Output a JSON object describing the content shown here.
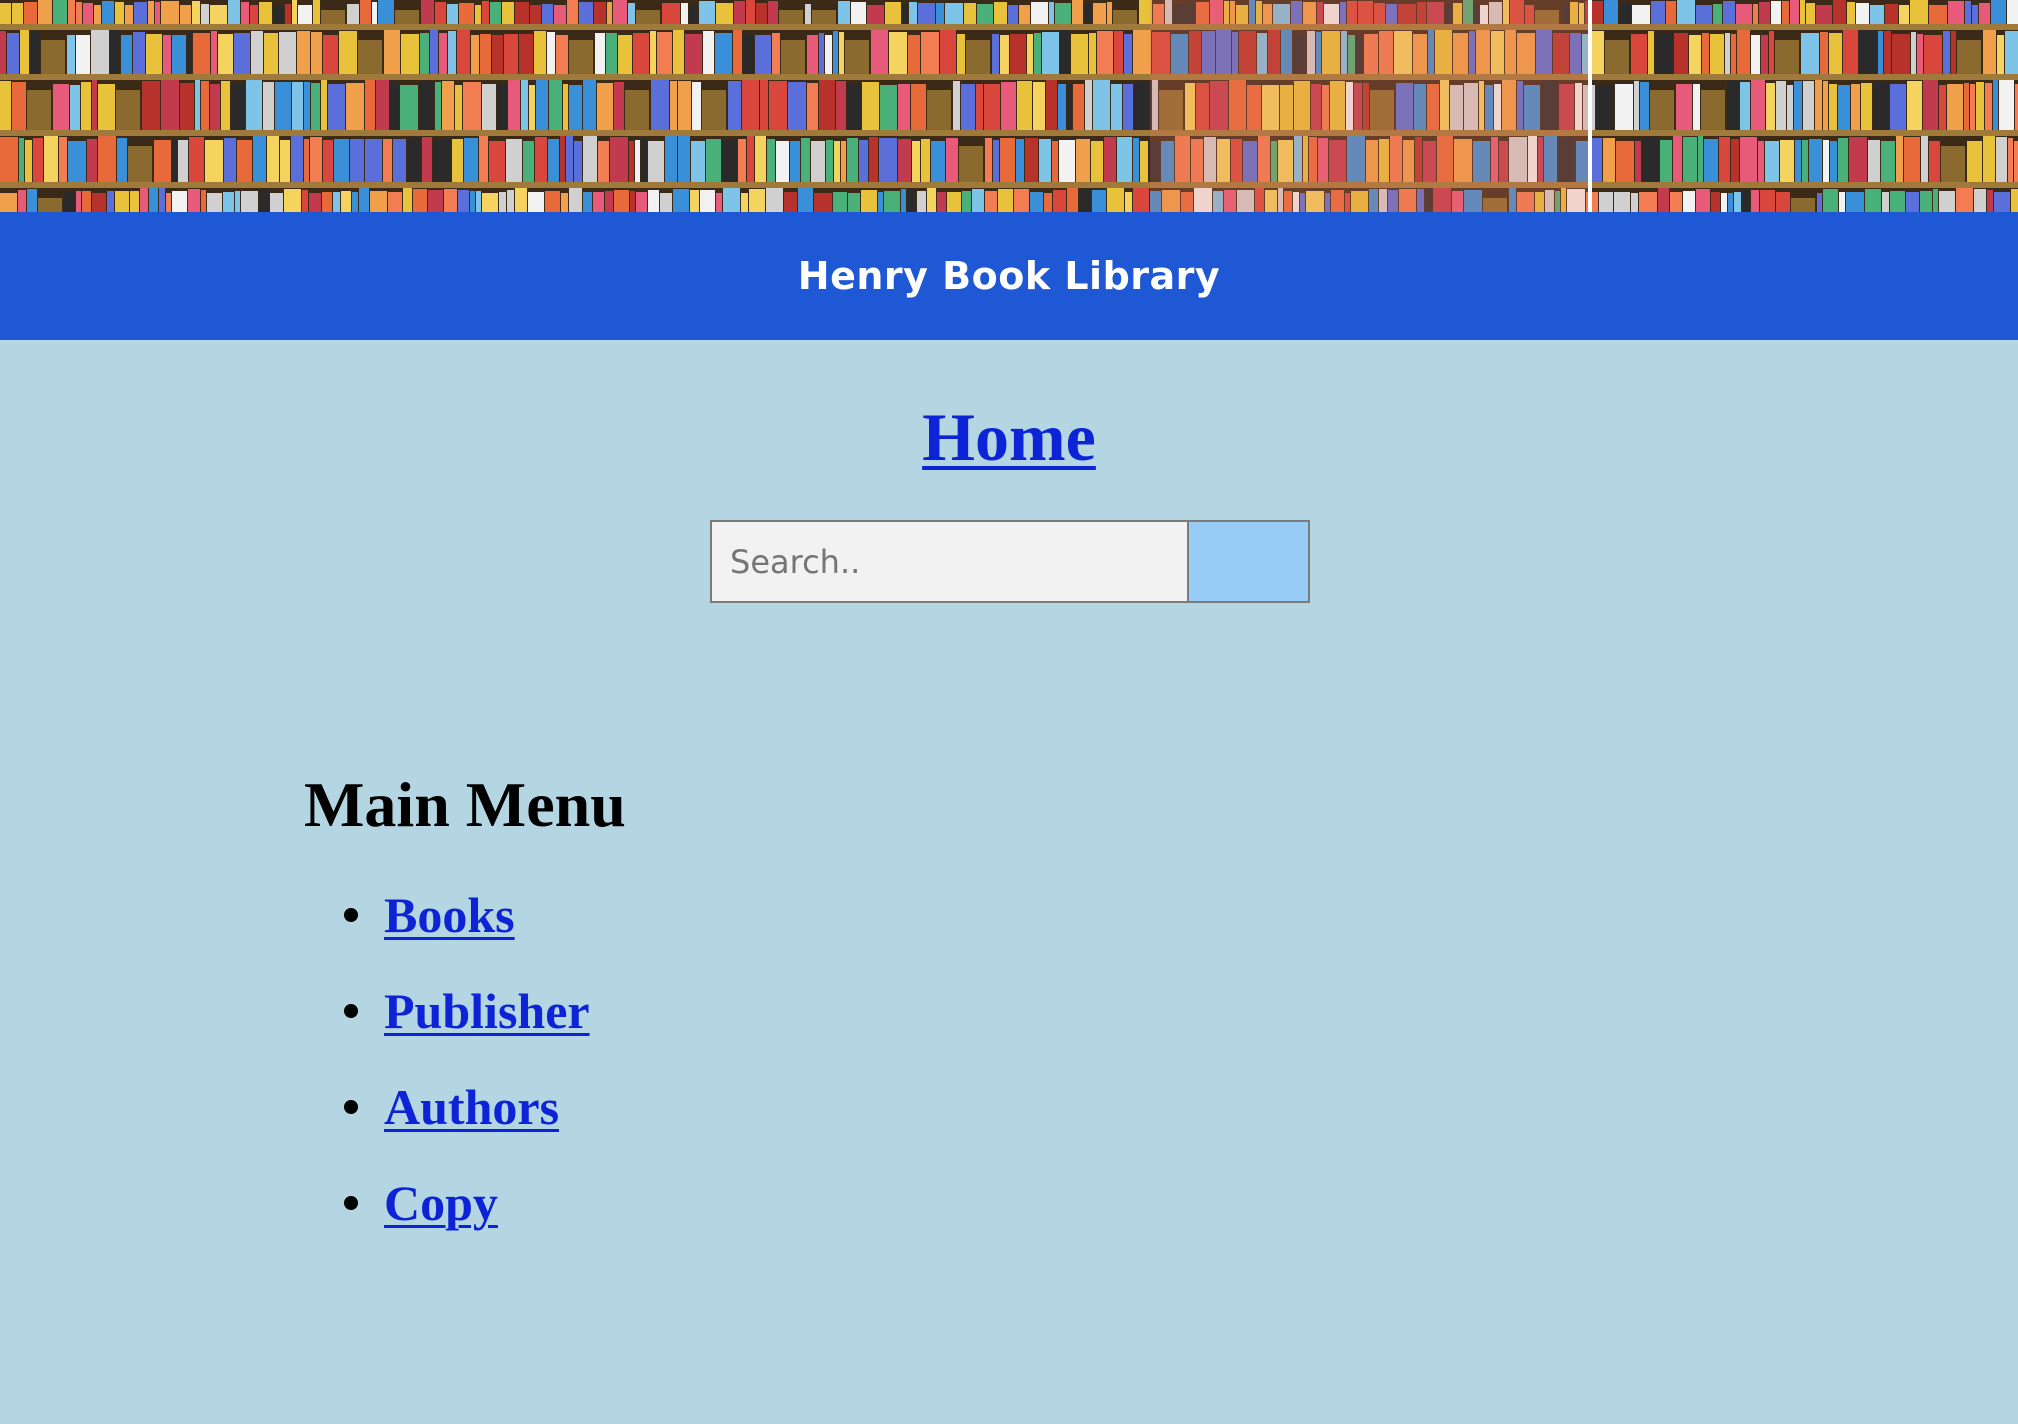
{
  "header": {
    "title": "Henry Book Library"
  },
  "nav": {
    "home_label": "Home"
  },
  "search": {
    "placeholder": "Search..",
    "value": ""
  },
  "main_menu": {
    "heading": "Main Menu",
    "items": [
      {
        "label": "Books"
      },
      {
        "label": "Publisher"
      },
      {
        "label": "Authors"
      },
      {
        "label": "Copy"
      }
    ]
  },
  "colors": {
    "title_bar": "#1e58d5",
    "page_background": "#b4d6e3",
    "link": "#0d24d6",
    "search_button": "#96ccf5"
  }
}
